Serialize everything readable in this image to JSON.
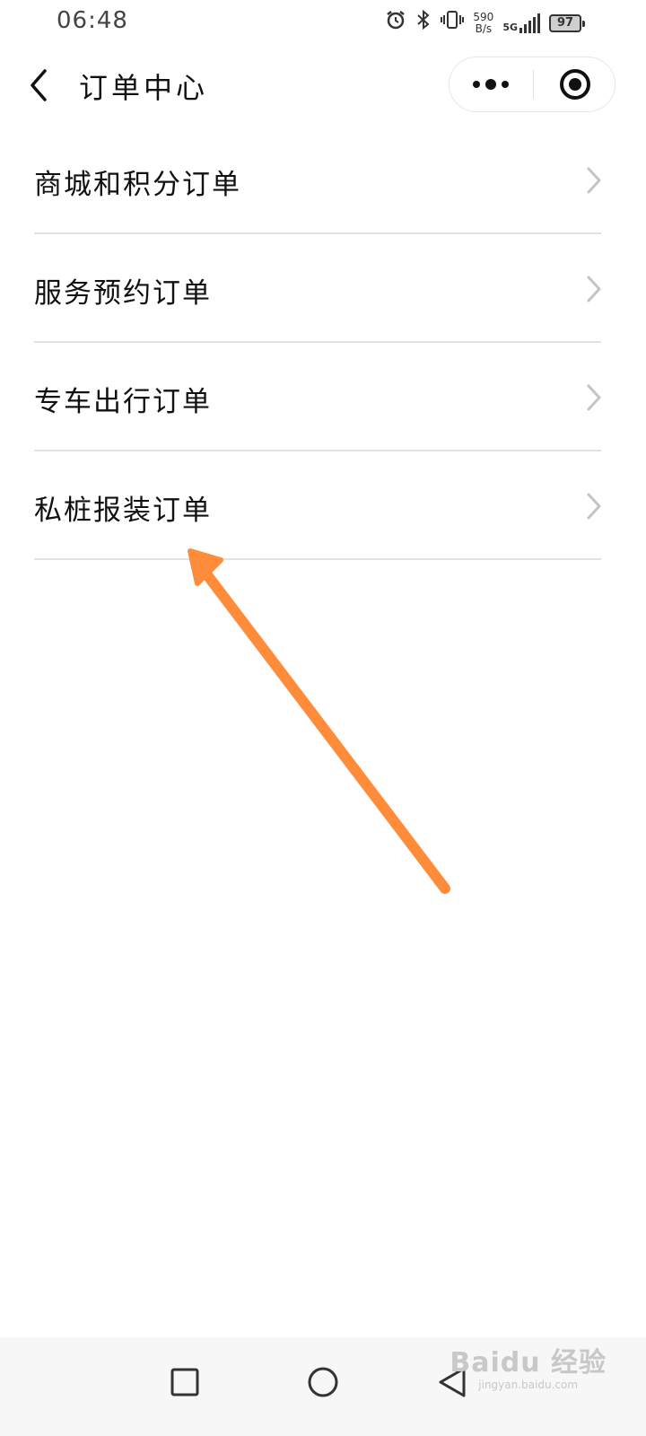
{
  "status_bar": {
    "time": "06:48",
    "icons": [
      "alarm-icon",
      "bluetooth-icon",
      "vibrate-icon"
    ],
    "net_speed_value": "590",
    "net_speed_unit": "B/s",
    "network_type": "5G",
    "battery": "97"
  },
  "nav": {
    "title": "订单中心"
  },
  "orders": {
    "items": [
      {
        "label": "商城和积分订单"
      },
      {
        "label": "服务预约订单"
      },
      {
        "label": "专车出行订单"
      },
      {
        "label": "私桩报装订单"
      }
    ]
  },
  "annotation": {
    "color": "#ff8c3a"
  },
  "watermark": {
    "main": "Baidu 经验",
    "sub": "jingyan.baidu.com"
  },
  "colors": {
    "divider": "#e2e2e2",
    "chevron": "#c4c4c4",
    "text": "#111111"
  }
}
